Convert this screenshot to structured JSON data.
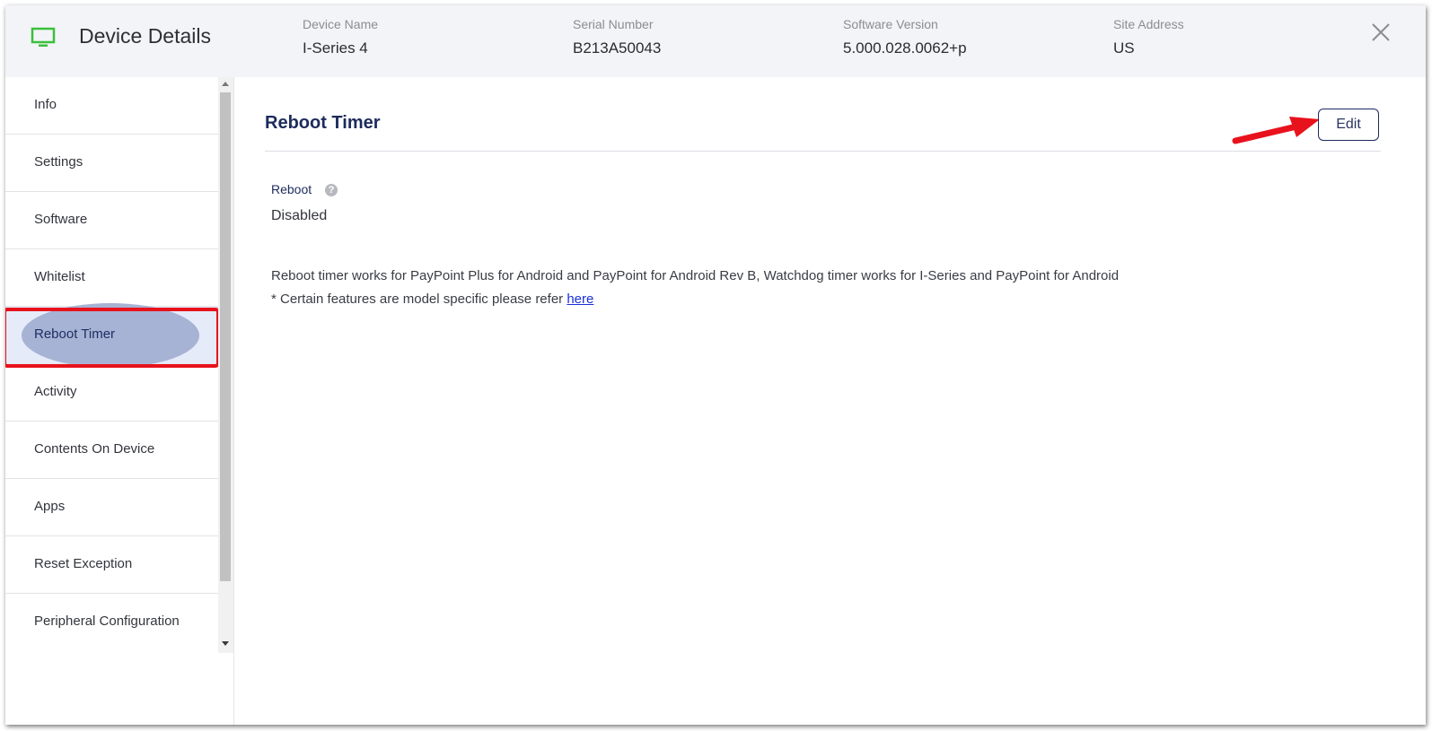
{
  "header": {
    "title": "Device Details",
    "icon": "monitor-icon",
    "icon_color": "#3bbf3b",
    "fields": [
      {
        "label": "Device Name",
        "value": "I-Series 4"
      },
      {
        "label": "Serial Number",
        "value": "B213A50043"
      },
      {
        "label": "Software Version",
        "value": "5.000.028.0062+p"
      },
      {
        "label": "Site Address",
        "value": "US"
      }
    ],
    "close_icon": "close-icon"
  },
  "sidebar": {
    "active": "Reboot Timer",
    "items": [
      {
        "label": "Info"
      },
      {
        "label": "Settings"
      },
      {
        "label": "Software"
      },
      {
        "label": "Whitelist"
      },
      {
        "label": "Reboot Timer"
      },
      {
        "label": "Activity"
      },
      {
        "label": "Contents On Device"
      },
      {
        "label": "Apps"
      },
      {
        "label": "Reset Exception"
      },
      {
        "label": "Peripheral Configuration"
      }
    ]
  },
  "main": {
    "section_title": "Reboot Timer",
    "edit_label": "Edit",
    "field_label": "Reboot",
    "help_glyph": "?",
    "field_value": "Disabled",
    "note": "Reboot timer works for PayPoint Plus for Android and PayPoint for Android Rev B, Watchdog timer works for I-Series and PayPoint for Android",
    "note2_prefix": "* Certain features are model specific please refer ",
    "note2_link": "here"
  },
  "colors": {
    "accent": "#1d2b5c",
    "annotation_red": "#e8121d",
    "active_bg": "#e6ebf9"
  }
}
